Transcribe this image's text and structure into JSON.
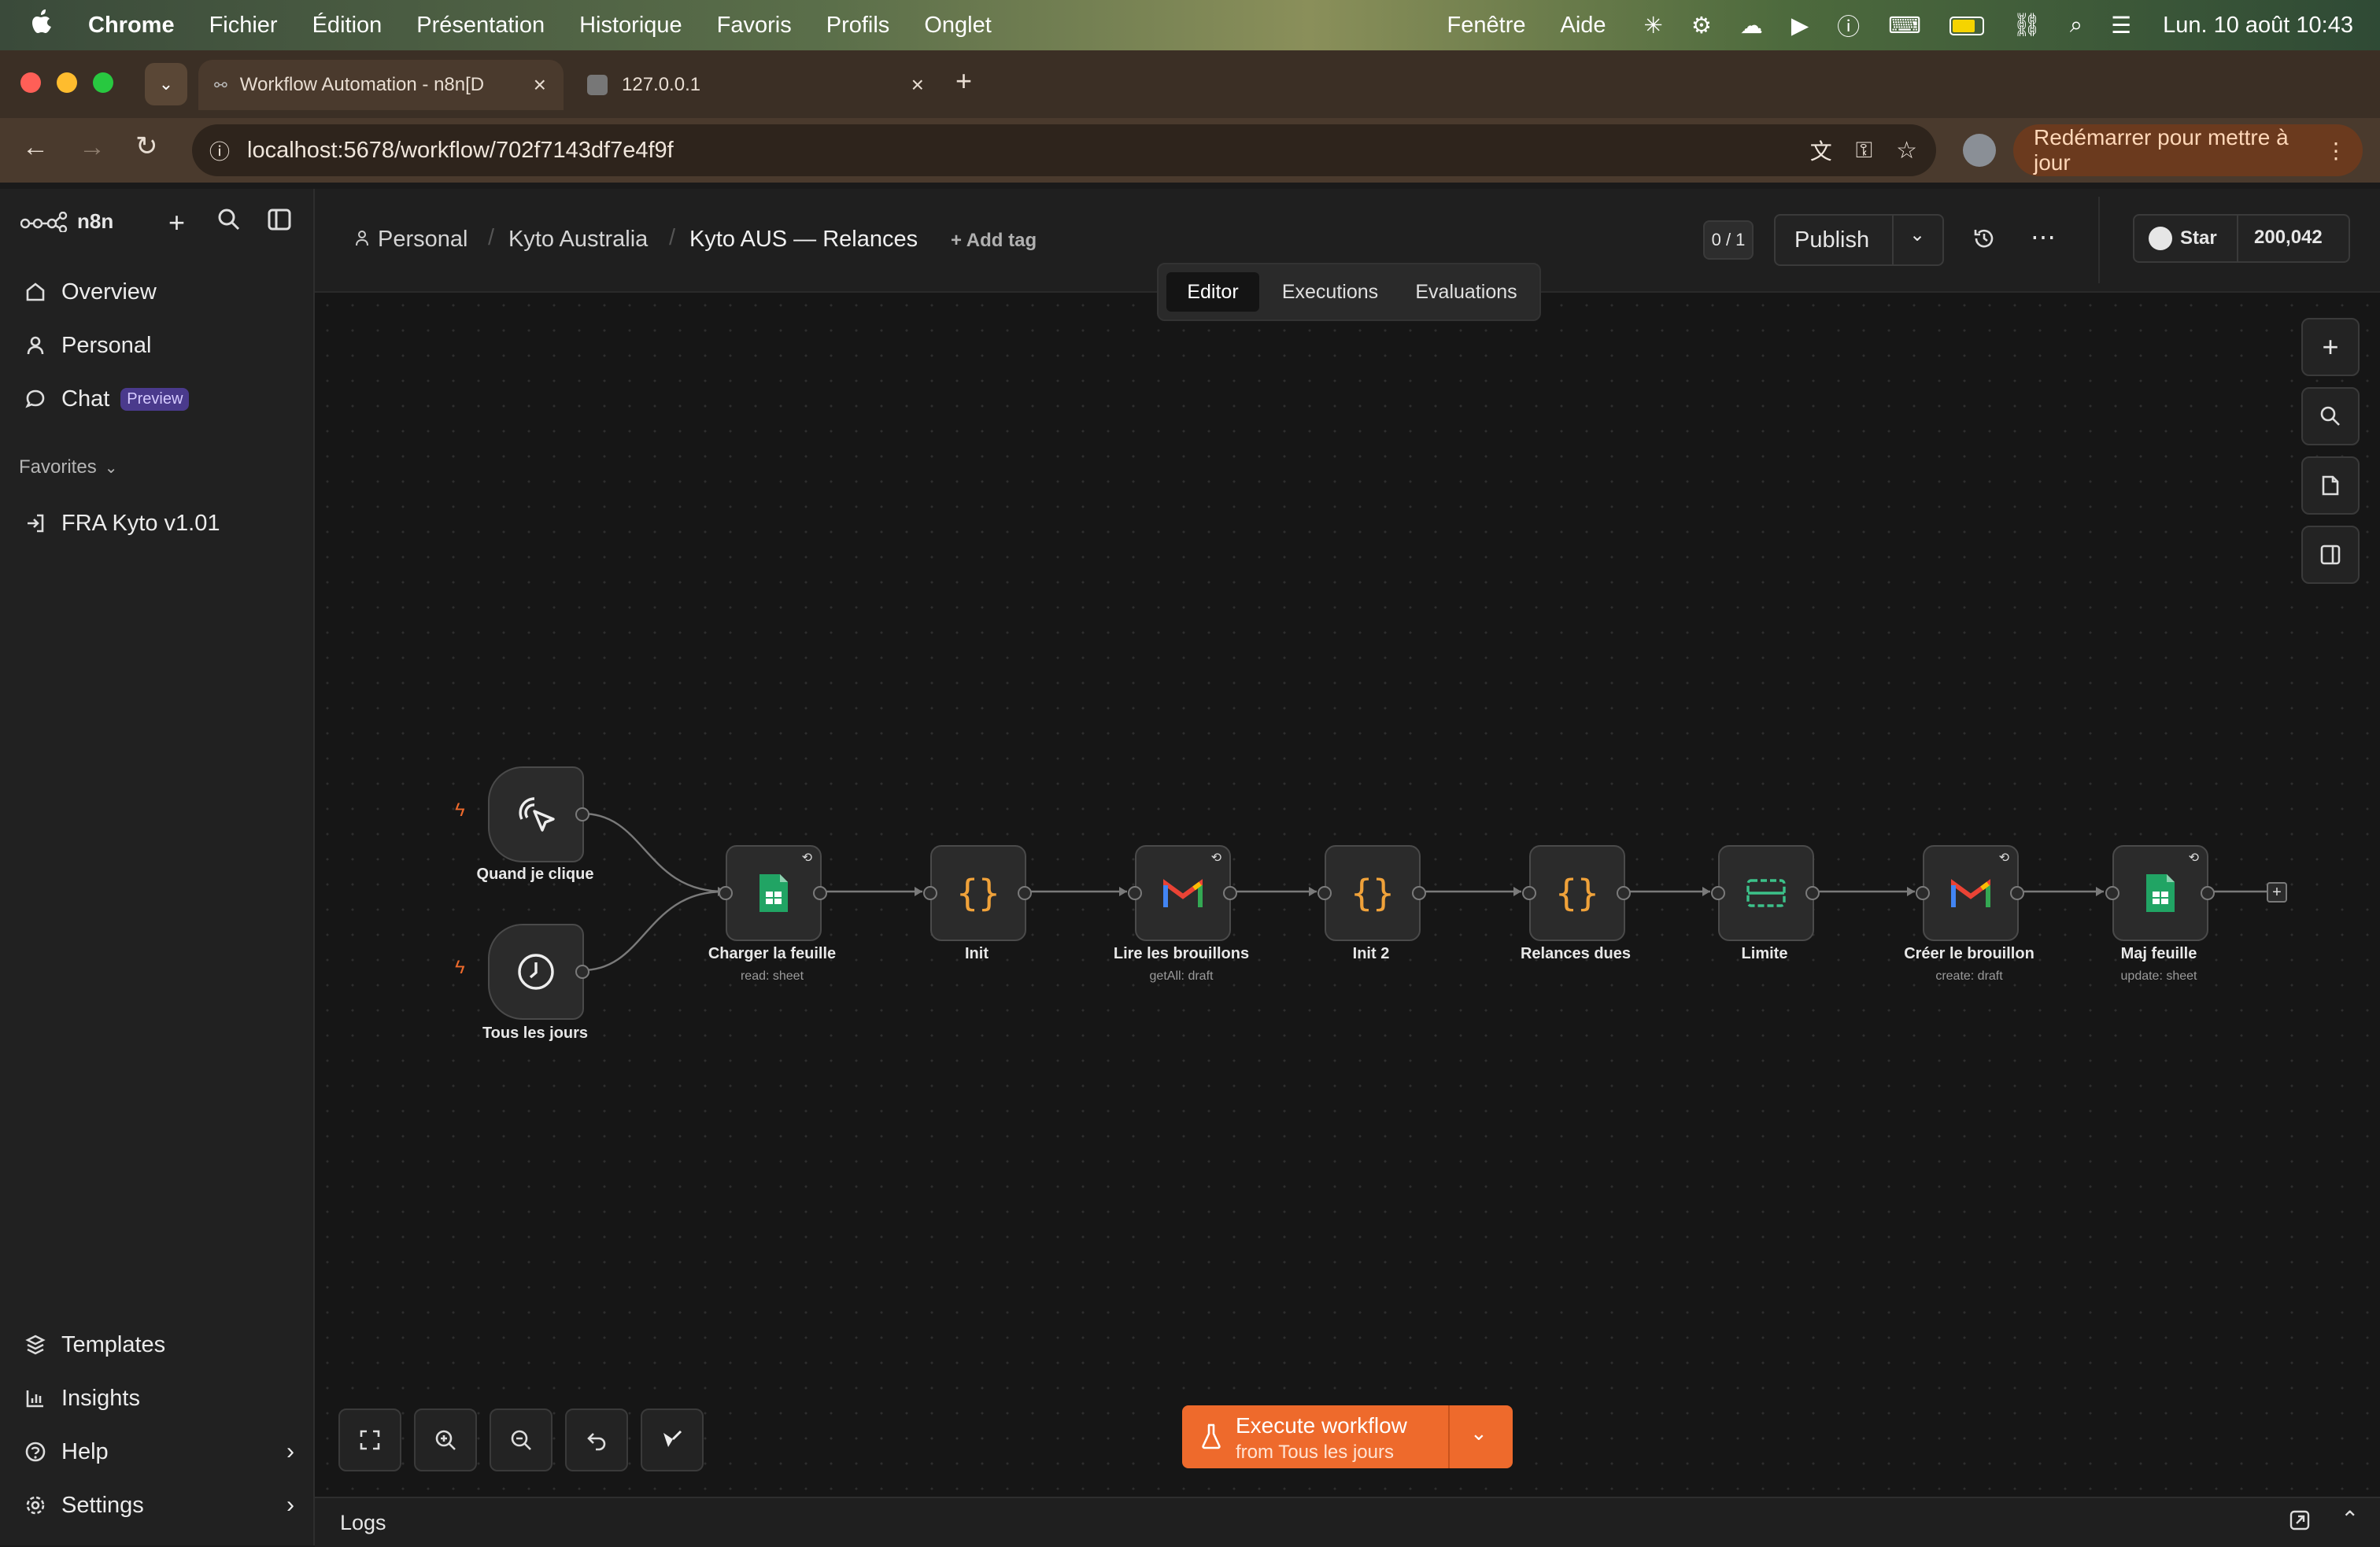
{
  "menubar": {
    "app": "Chrome",
    "items": [
      "Fichier",
      "Édition",
      "Présentation",
      "Historique",
      "Favoris",
      "Profils",
      "Onglet"
    ],
    "right_items": [
      "Fenêtre",
      "Aide"
    ],
    "clock": "Lun. 10 août 10:43"
  },
  "browser": {
    "tabs": [
      {
        "title": "Workflow Automation - n8n[D"
      },
      {
        "title": "127.0.0.1"
      }
    ],
    "url": "localhost:5678/workflow/702f7143df7e4f9f",
    "restart_label": "Redémarrer pour mettre à jour"
  },
  "sidebar": {
    "brand": "n8n",
    "nav": [
      {
        "label": "Overview",
        "icon": "home-icon"
      },
      {
        "label": "Personal",
        "icon": "user-icon"
      },
      {
        "label": "Chat",
        "icon": "chat-icon",
        "badge": "Preview"
      }
    ],
    "favorites_label": "Favorites",
    "favorites": [
      {
        "label": "FRA Kyto v1.01"
      }
    ],
    "bottom": [
      {
        "label": "Templates",
        "icon": "templates-icon"
      },
      {
        "label": "Insights",
        "icon": "insights-icon"
      },
      {
        "label": "Help",
        "icon": "help-icon"
      },
      {
        "label": "Settings",
        "icon": "settings-icon"
      }
    ]
  },
  "header": {
    "breadcrumb": [
      "Personal",
      "Kyto Australia",
      "Kyto AUS — Relances"
    ],
    "add_tag": "+ Add tag",
    "version_counter": "0 / 1",
    "publish": "Publish",
    "star_label": "Star",
    "star_count": "200,042",
    "tabs": [
      "Editor",
      "Executions",
      "Evaluations"
    ],
    "active_tab": "Editor"
  },
  "nodes": [
    {
      "name": "Quand je clique",
      "subtitle": "",
      "icon": "pointer-click-icon"
    },
    {
      "name": "Tous les jours",
      "subtitle": "",
      "icon": "clock-icon"
    },
    {
      "name": "Charger la feuille",
      "subtitle": "read: sheet",
      "icon": "google-sheets-icon"
    },
    {
      "name": "Init",
      "subtitle": "",
      "icon": "code-braces-icon"
    },
    {
      "name": "Lire les brouillons",
      "subtitle": "getAll: draft",
      "icon": "gmail-icon"
    },
    {
      "name": "Init 2",
      "subtitle": "",
      "icon": "code-braces-icon"
    },
    {
      "name": "Relances dues",
      "subtitle": "",
      "icon": "code-braces-icon"
    },
    {
      "name": "Limite",
      "subtitle": "",
      "icon": "limit-icon"
    },
    {
      "name": "Créer le brouillon",
      "subtitle": "create: draft",
      "icon": "gmail-icon"
    },
    {
      "name": "Maj feuille",
      "subtitle": "update: sheet",
      "icon": "google-sheets-icon"
    }
  ],
  "execute": {
    "label": "Execute workflow",
    "sub": "from Tous les jours"
  },
  "logs_label": "Logs",
  "colors": {
    "accent": "#ee6a2c",
    "canvas": "#161616",
    "sidebar": "#212121",
    "badge": "#7c5cff"
  }
}
